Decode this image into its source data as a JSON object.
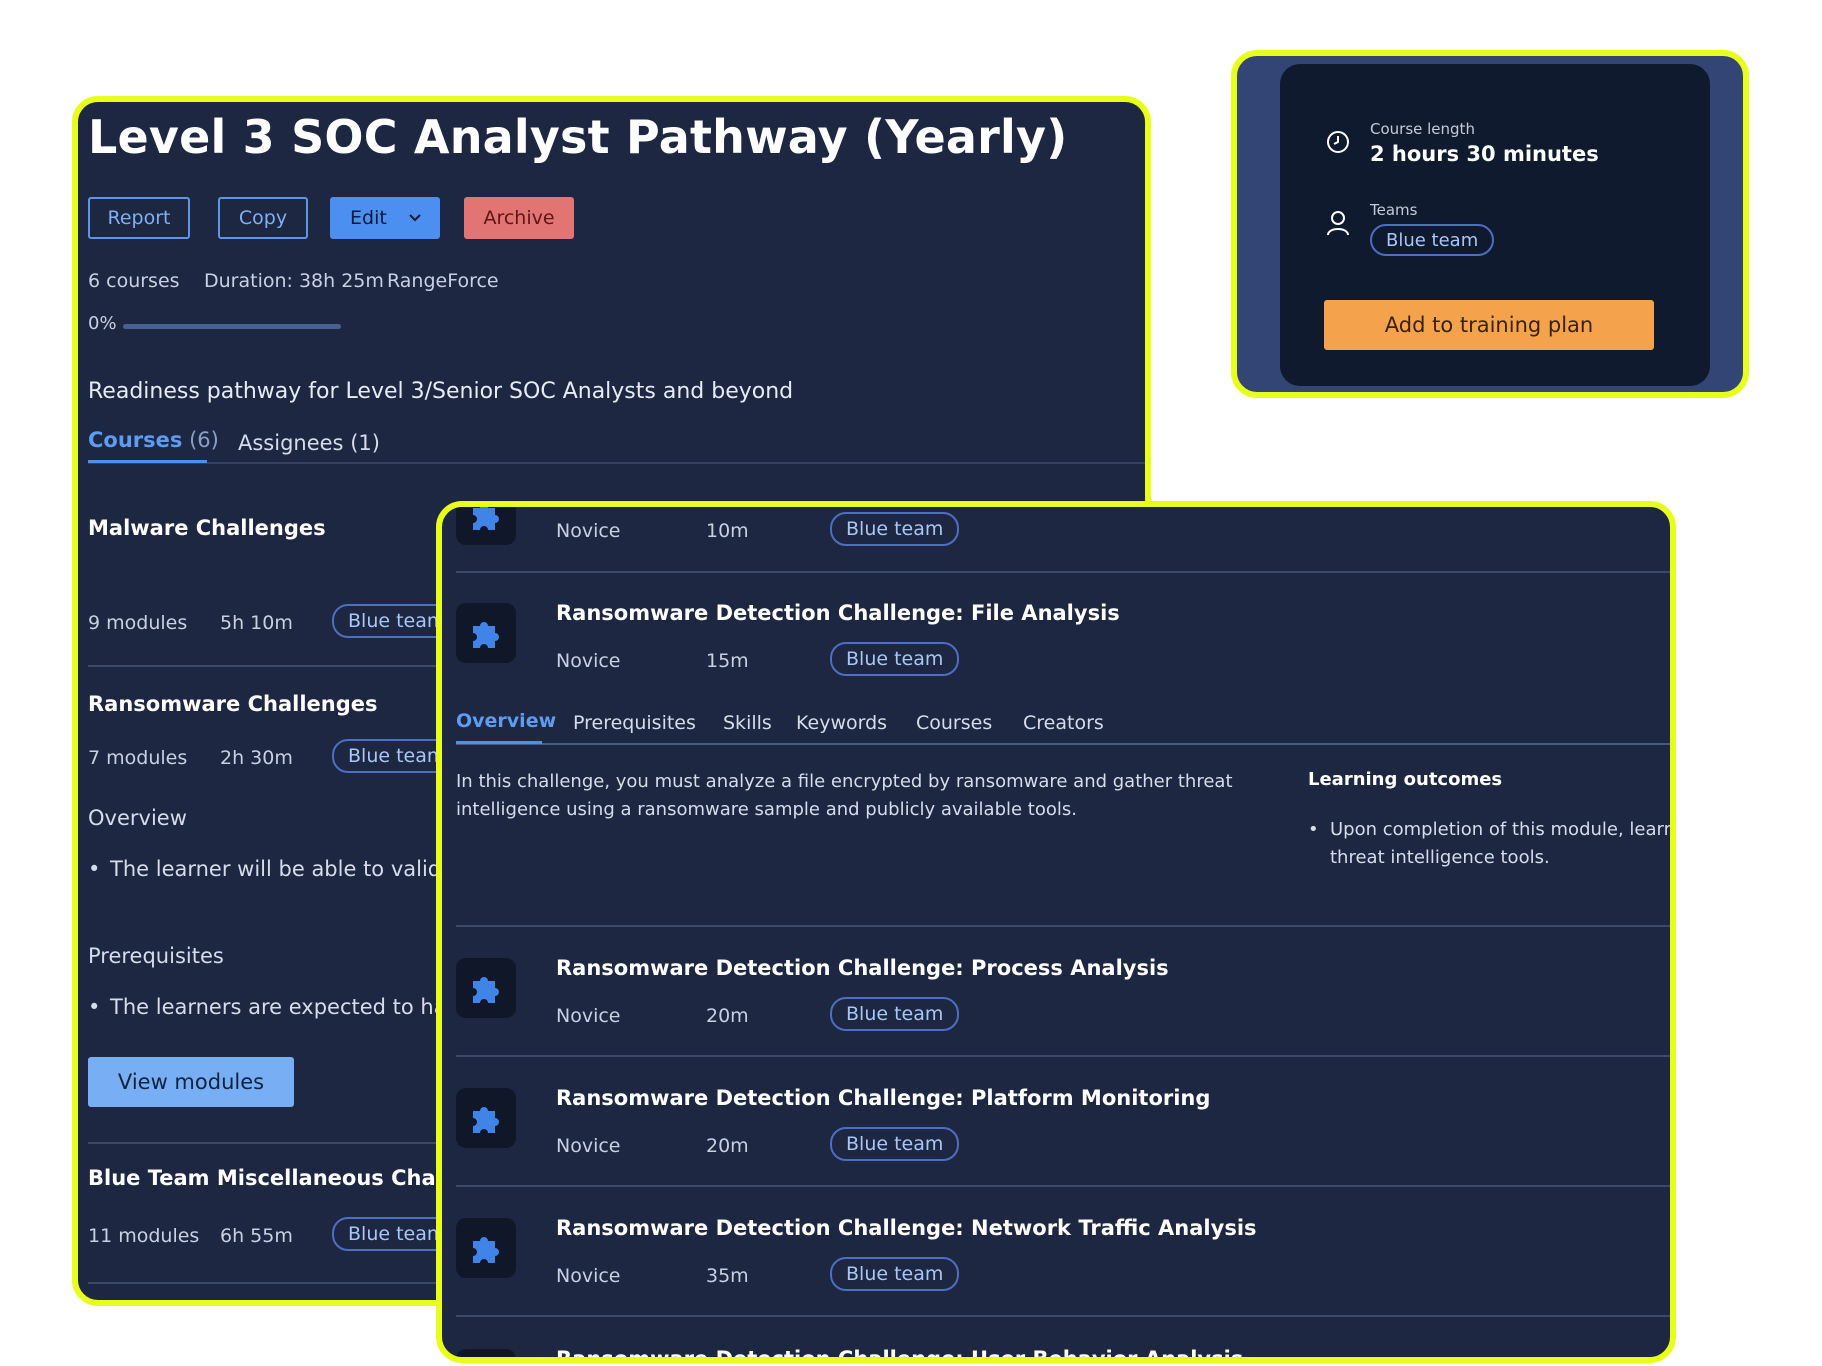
{
  "pathway": {
    "title": "Level 3 SOC Analyst Pathway (Yearly)",
    "actions": {
      "report": "Report",
      "copy": "Copy",
      "edit": "Edit",
      "archive": "Archive"
    },
    "meta": {
      "courses": "6 courses",
      "duration": "Duration: 38h 25m",
      "provider": "RangeForce"
    },
    "progress": {
      "label": "0%",
      "value": 0
    },
    "description": "Readiness pathway for Level 3/Senior SOC Analysts and beyond",
    "tabs": [
      {
        "label": "Courses",
        "count": "(6)"
      },
      {
        "label": "Assignees",
        "count": "(1)"
      }
    ],
    "courses": [
      {
        "title": "Malware Challenges",
        "modules": "9 modules",
        "duration": "5h 10m",
        "team": "Blue team"
      },
      {
        "title": "Ransomware Challenges",
        "modules": "7 modules",
        "duration": "2h 30m",
        "team": "Blue team"
      },
      {
        "title": "Blue Team Miscellaneous Challen",
        "modules": "11 modules",
        "duration": "6h 55m",
        "team": "Blue team"
      }
    ],
    "expanded": {
      "overview_heading": "Overview",
      "overview_bullet": "The learner will be able to valida",
      "prereq_heading": "Prerequisites",
      "prereq_bullet": "The learners are expected to hav",
      "view_button": "View modules"
    }
  },
  "course_info": {
    "length_label": "Course length",
    "length_value": "2 hours 30 minutes",
    "teams_label": "Teams",
    "team": "Blue team",
    "add_button": "Add to training plan"
  },
  "modules": {
    "top_partial": {
      "level": "Novice",
      "duration": "10m",
      "team": "Blue team"
    },
    "items": [
      {
        "title": "Ransomware Detection Challenge: File Analysis",
        "level": "Novice",
        "duration": "15m",
        "team": "Blue team"
      },
      {
        "title": "Ransomware Detection Challenge: Process Analysis",
        "level": "Novice",
        "duration": "20m",
        "team": "Blue team"
      },
      {
        "title": "Ransomware Detection Challenge: Platform Monitoring",
        "level": "Novice",
        "duration": "20m",
        "team": "Blue team"
      },
      {
        "title": "Ransomware Detection Challenge: Network Traffic Analysis",
        "level": "Novice",
        "duration": "35m",
        "team": "Blue team"
      },
      {
        "title": "Ransomware Detection Challenge: User Behavior Analysis"
      }
    ],
    "detail_tabs": [
      "Overview",
      "Prerequisites",
      "Skills",
      "Keywords",
      "Courses",
      "Creators"
    ],
    "overview_text": "In this challenge, you must analyze a file encrypted by ransomware and gather threat intelligence using a ransomware sample and publicly available tools.",
    "learning_outcomes_heading": "Learning outcomes",
    "learning_outcome": "Upon completion of this module, learr threat intelligence tools."
  },
  "colors": {
    "frame": "#e8ff1c",
    "panel": "#1d2741",
    "accent": "#4c8ff0",
    "archive": "#e27474",
    "cta": "#f5a24d"
  }
}
